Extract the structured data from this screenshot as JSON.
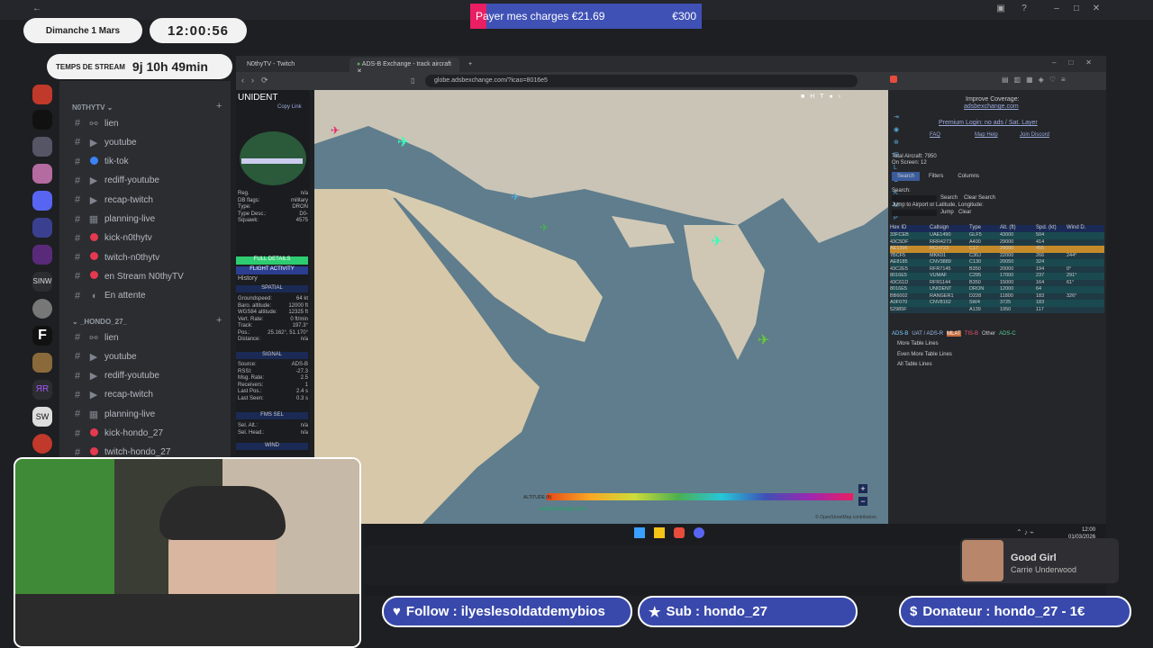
{
  "overlay": {
    "date": "Dimanche 1 Mars",
    "clock": "12:00:56",
    "stream_label": "TEMPS DE STREAM",
    "stream_time": "9j 10h 49min",
    "goal_text": "Payer mes charges €21.69",
    "goal_target": "€300",
    "follow": "Follow : ilyeslesoldatdemybios",
    "sub": "Sub : hondo_27",
    "donor": "Donateur : hondo_27 - 1€",
    "alert_title": "Good Girl",
    "alert_artist": "Carrie Underwood",
    "colors": {
      "banner": "#3949ab",
      "goal": "#3f51b5",
      "goal_fill": "#e91e63"
    }
  },
  "discord": {
    "cat1": "N0THYTV",
    "cat2": "_HONDO_27_",
    "channels1": [
      {
        "name": "lien",
        "icon": "link-icon"
      },
      {
        "name": "youtube",
        "icon": "hash-icon"
      },
      {
        "name": "tik-tok",
        "icon": "hash-icon",
        "dot": "#3b82f6"
      },
      {
        "name": "rediff-youtube",
        "icon": "hash-icon"
      },
      {
        "name": "recap-twitch",
        "icon": "hash-icon"
      },
      {
        "name": "planning-live",
        "icon": "calendar-icon"
      },
      {
        "name": "kick-n0thytv",
        "icon": "hash-icon",
        "dot": "#e53950"
      },
      {
        "name": "twitch-n0thytv",
        "icon": "hash-icon",
        "dot": "#e53950"
      },
      {
        "name": "en Stream N0thyTV",
        "icon": "hash-icon",
        "dot": "#e53950"
      },
      {
        "name": "En attente",
        "icon": "speaker-icon"
      }
    ],
    "channels2": [
      {
        "name": "lien",
        "icon": "link-icon"
      },
      {
        "name": "youtube",
        "icon": "hash-icon"
      },
      {
        "name": "rediff-youtube",
        "icon": "hash-icon"
      },
      {
        "name": "recap-twitch",
        "icon": "hash-icon"
      },
      {
        "name": "planning-live",
        "icon": "calendar-icon"
      },
      {
        "name": "kick-hondo_27",
        "icon": "hash-icon",
        "dot": "#e53950"
      },
      {
        "name": "twitch-hondo_27",
        "icon": "hash-icon",
        "dot": "#e53950"
      }
    ]
  },
  "browser": {
    "tab1": "N0thyTV - Twitch",
    "tab2": "ADS-B Exchange - track aircraft",
    "url": "globe.adsbexchange.com/?icao=8016e5",
    "info": {
      "callsign": "UNIDENT",
      "copy": "Copy Link",
      "rows": [
        [
          "Reg.",
          "n/a"
        ],
        [
          "DB flags:",
          "military"
        ],
        [
          "Type:",
          "DRON"
        ],
        [
          "Type Desc.:",
          "D0-"
        ],
        [
          "Squawk:",
          "4575"
        ]
      ],
      "full_details": "FULL DETAILS",
      "flight_activity": "FLIGHT ACTIVITY",
      "history": "History",
      "spatial": "SPATIAL",
      "rows2": [
        [
          "Groundspeed:",
          "64 kt"
        ],
        [
          "Baro. altitude:",
          "12000 ft"
        ],
        [
          "WGS84 altitude:",
          "12325 ft"
        ],
        [
          "Vert. Rate:",
          "0 ft/min"
        ],
        [
          "Track:",
          "197.3°"
        ],
        [
          "Pos.:",
          "25.162°, 51.170°"
        ],
        [
          "Distance:",
          "n/a"
        ]
      ],
      "signal": "SIGNAL",
      "rows3": [
        [
          "Source:",
          "ADS-B"
        ],
        [
          "RSSI:",
          "-27.3"
        ],
        [
          "Msg. Rate:",
          "2.5"
        ],
        [
          "Receivers:",
          "1"
        ],
        [
          "Last Pos.:",
          "2.4 s"
        ],
        [
          "Last Seen:",
          "0.3 s"
        ]
      ],
      "fms": "FMS SEL",
      "rows4": [
        [
          "Sel. Alt.:",
          "n/a"
        ],
        [
          "Sel. Head.:",
          "n/a"
        ]
      ],
      "wind": "WIND"
    },
    "right": {
      "improve": "Improve Coverage:",
      "site": "adsbexchange.com",
      "premium": "Premium Login: no ads / Sat. Layer",
      "faq": "FAQ",
      "map_help": "Map Help",
      "discord": "Join Discord",
      "total": "Total Aircraft: 7950",
      "onscreen": "On Screen: 12",
      "tabs": [
        "Search",
        "Filters",
        "Columns"
      ],
      "search_label": "Search:",
      "search_btn": "Search",
      "clear_btn": "Clear Search",
      "jump_label": "Jump to Airport or Latitude, Longitude:",
      "jump_btn": "Jump",
      "clear2": "Clear",
      "headers": [
        "Hex ID",
        "Callsign",
        "Type",
        "Alt. (ft)",
        "Spd. (kt)",
        "Wind D."
      ],
      "rows": [
        [
          "33FCEB",
          "UAE1490",
          "GLF5",
          "43000",
          "504",
          ""
        ],
        [
          "43C5DF",
          "RRR4273",
          "A400",
          "29000",
          "414",
          ""
        ],
        [
          "AE1396",
          "RCH723",
          "C17",
          "29000",
          "455",
          ""
        ],
        [
          "7BCF5",
          "MKK01",
          "C30J",
          "22000",
          "266",
          "244°"
        ],
        [
          "AE8185",
          "CNV3889",
          "C130",
          "20050",
          "324",
          ""
        ],
        [
          "43C2E5",
          "RFR7145",
          "B350",
          "20000",
          "194",
          "0°"
        ],
        [
          "8016E5",
          "VUMAF",
          "C295",
          "17000",
          "237",
          "291°"
        ],
        [
          "43C61D",
          "RFR1144",
          "B350",
          "15000",
          "164",
          "61°"
        ],
        [
          "8016E5",
          "UNIDENT",
          "DRON",
          "12000",
          "64",
          ""
        ],
        [
          "BB6002",
          "RANGER1",
          "D228",
          "11800",
          "183",
          "326°"
        ],
        [
          "A0F070",
          "CNV8162",
          "SW4",
          "3725",
          "183",
          ""
        ],
        [
          "52985F",
          "",
          "A139",
          "1950",
          "117",
          ""
        ]
      ],
      "sources": [
        "ADS-B",
        "UAT / ADS-R",
        "MLAT",
        "TIS-B",
        "Other",
        "ADS-C"
      ],
      "more": "More Table Lines",
      "even_more": "Even More Table Lines",
      "all": "All Table Lines"
    },
    "legend_label": "ALTITUDE (ft)",
    "watermark": "adsbexchange.com",
    "attribution": "© OpenStreetMap contributors"
  },
  "taskbar": {
    "time": "12:00",
    "date": "01/03/2026"
  }
}
